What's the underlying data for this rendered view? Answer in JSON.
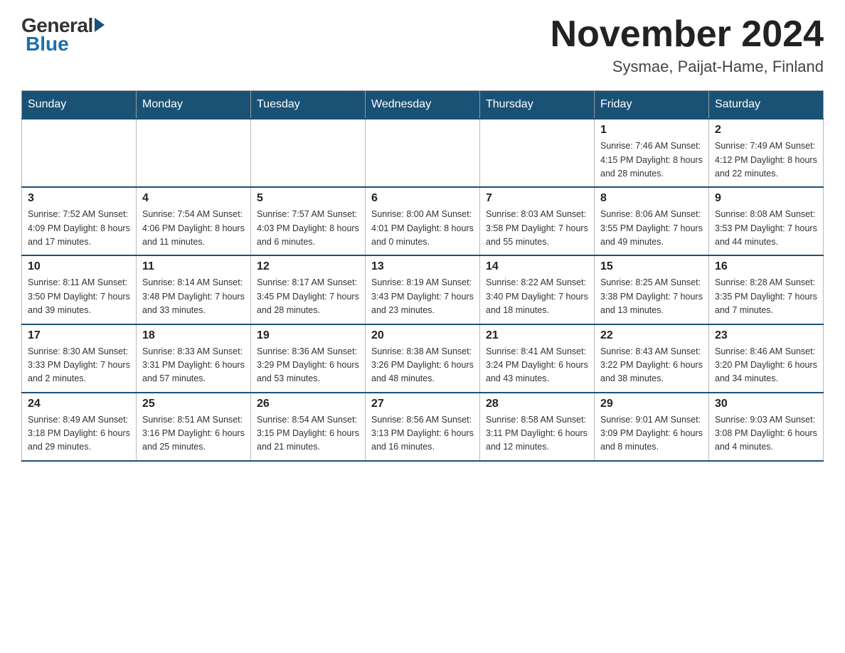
{
  "logo": {
    "general": "General",
    "blue": "Blue",
    "subtitle": "Blue"
  },
  "header": {
    "month_title": "November 2024",
    "location": "Sysmae, Paijat-Hame, Finland"
  },
  "days_of_week": [
    "Sunday",
    "Monday",
    "Tuesday",
    "Wednesday",
    "Thursday",
    "Friday",
    "Saturday"
  ],
  "weeks": [
    {
      "days": [
        {
          "num": "",
          "info": ""
        },
        {
          "num": "",
          "info": ""
        },
        {
          "num": "",
          "info": ""
        },
        {
          "num": "",
          "info": ""
        },
        {
          "num": "",
          "info": ""
        },
        {
          "num": "1",
          "info": "Sunrise: 7:46 AM\nSunset: 4:15 PM\nDaylight: 8 hours\nand 28 minutes."
        },
        {
          "num": "2",
          "info": "Sunrise: 7:49 AM\nSunset: 4:12 PM\nDaylight: 8 hours\nand 22 minutes."
        }
      ]
    },
    {
      "days": [
        {
          "num": "3",
          "info": "Sunrise: 7:52 AM\nSunset: 4:09 PM\nDaylight: 8 hours\nand 17 minutes."
        },
        {
          "num": "4",
          "info": "Sunrise: 7:54 AM\nSunset: 4:06 PM\nDaylight: 8 hours\nand 11 minutes."
        },
        {
          "num": "5",
          "info": "Sunrise: 7:57 AM\nSunset: 4:03 PM\nDaylight: 8 hours\nand 6 minutes."
        },
        {
          "num": "6",
          "info": "Sunrise: 8:00 AM\nSunset: 4:01 PM\nDaylight: 8 hours\nand 0 minutes."
        },
        {
          "num": "7",
          "info": "Sunrise: 8:03 AM\nSunset: 3:58 PM\nDaylight: 7 hours\nand 55 minutes."
        },
        {
          "num": "8",
          "info": "Sunrise: 8:06 AM\nSunset: 3:55 PM\nDaylight: 7 hours\nand 49 minutes."
        },
        {
          "num": "9",
          "info": "Sunrise: 8:08 AM\nSunset: 3:53 PM\nDaylight: 7 hours\nand 44 minutes."
        }
      ]
    },
    {
      "days": [
        {
          "num": "10",
          "info": "Sunrise: 8:11 AM\nSunset: 3:50 PM\nDaylight: 7 hours\nand 39 minutes."
        },
        {
          "num": "11",
          "info": "Sunrise: 8:14 AM\nSunset: 3:48 PM\nDaylight: 7 hours\nand 33 minutes."
        },
        {
          "num": "12",
          "info": "Sunrise: 8:17 AM\nSunset: 3:45 PM\nDaylight: 7 hours\nand 28 minutes."
        },
        {
          "num": "13",
          "info": "Sunrise: 8:19 AM\nSunset: 3:43 PM\nDaylight: 7 hours\nand 23 minutes."
        },
        {
          "num": "14",
          "info": "Sunrise: 8:22 AM\nSunset: 3:40 PM\nDaylight: 7 hours\nand 18 minutes."
        },
        {
          "num": "15",
          "info": "Sunrise: 8:25 AM\nSunset: 3:38 PM\nDaylight: 7 hours\nand 13 minutes."
        },
        {
          "num": "16",
          "info": "Sunrise: 8:28 AM\nSunset: 3:35 PM\nDaylight: 7 hours\nand 7 minutes."
        }
      ]
    },
    {
      "days": [
        {
          "num": "17",
          "info": "Sunrise: 8:30 AM\nSunset: 3:33 PM\nDaylight: 7 hours\nand 2 minutes."
        },
        {
          "num": "18",
          "info": "Sunrise: 8:33 AM\nSunset: 3:31 PM\nDaylight: 6 hours\nand 57 minutes."
        },
        {
          "num": "19",
          "info": "Sunrise: 8:36 AM\nSunset: 3:29 PM\nDaylight: 6 hours\nand 53 minutes."
        },
        {
          "num": "20",
          "info": "Sunrise: 8:38 AM\nSunset: 3:26 PM\nDaylight: 6 hours\nand 48 minutes."
        },
        {
          "num": "21",
          "info": "Sunrise: 8:41 AM\nSunset: 3:24 PM\nDaylight: 6 hours\nand 43 minutes."
        },
        {
          "num": "22",
          "info": "Sunrise: 8:43 AM\nSunset: 3:22 PM\nDaylight: 6 hours\nand 38 minutes."
        },
        {
          "num": "23",
          "info": "Sunrise: 8:46 AM\nSunset: 3:20 PM\nDaylight: 6 hours\nand 34 minutes."
        }
      ]
    },
    {
      "days": [
        {
          "num": "24",
          "info": "Sunrise: 8:49 AM\nSunset: 3:18 PM\nDaylight: 6 hours\nand 29 minutes."
        },
        {
          "num": "25",
          "info": "Sunrise: 8:51 AM\nSunset: 3:16 PM\nDaylight: 6 hours\nand 25 minutes."
        },
        {
          "num": "26",
          "info": "Sunrise: 8:54 AM\nSunset: 3:15 PM\nDaylight: 6 hours\nand 21 minutes."
        },
        {
          "num": "27",
          "info": "Sunrise: 8:56 AM\nSunset: 3:13 PM\nDaylight: 6 hours\nand 16 minutes."
        },
        {
          "num": "28",
          "info": "Sunrise: 8:58 AM\nSunset: 3:11 PM\nDaylight: 6 hours\nand 12 minutes."
        },
        {
          "num": "29",
          "info": "Sunrise: 9:01 AM\nSunset: 3:09 PM\nDaylight: 6 hours\nand 8 minutes."
        },
        {
          "num": "30",
          "info": "Sunrise: 9:03 AM\nSunset: 3:08 PM\nDaylight: 6 hours\nand 4 minutes."
        }
      ]
    }
  ]
}
